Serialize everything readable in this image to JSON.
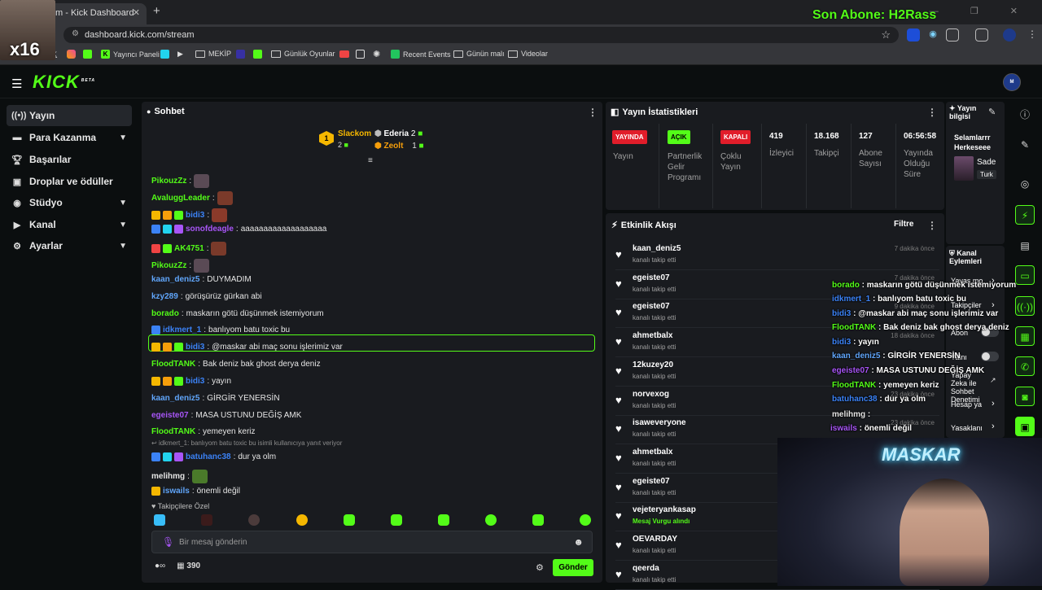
{
  "browser": {
    "tab_title": "m - Kick Dashboard",
    "url": "dashboard.kick.com/stream",
    "bookmarks": [
      "Yayıncı Paneli",
      "MEKİP",
      "Günlük Oyunlar",
      "Recent Events",
      "Günün malı",
      "Videolar"
    ]
  },
  "stream_overlay": {
    "last_sub": "Son Abone: H2Rass",
    "cam_label": "x16",
    "neon_sign": "MASKAR"
  },
  "brand": {
    "logo": "KICK",
    "tag": "BETA",
    "accent": "#53fc18"
  },
  "sidebar": {
    "items": [
      {
        "label": "Yayın",
        "icon": "broadcast-icon",
        "active": true
      },
      {
        "label": "Para Kazanma",
        "icon": "wallet-icon",
        "chevron": true
      },
      {
        "label": "Başarılar",
        "icon": "trophy-icon"
      },
      {
        "label": "Droplar ve ödüller",
        "icon": "gift-icon"
      },
      {
        "label": "Stüdyo",
        "icon": "studio-icon",
        "chevron": true
      },
      {
        "label": "Kanal",
        "icon": "channel-icon",
        "chevron": true
      },
      {
        "label": "Ayarlar",
        "icon": "gear-icon",
        "chevron": true
      }
    ]
  },
  "chat": {
    "title": "Sohbet",
    "podium": {
      "first": {
        "name": "Slackom",
        "count": "2"
      },
      "second": {
        "name": "Ederia",
        "count": "2"
      },
      "third": {
        "name": "Zeolt",
        "count": "1"
      }
    },
    "messages": [
      {
        "user": "PikouzZz",
        "text": "",
        "color": "#53fc18"
      },
      {
        "user": "AvaluggLeader",
        "text": "",
        "color": "#53fc18"
      },
      {
        "user": "bidi3",
        "text": "",
        "color": "#3b82f6"
      },
      {
        "user": "sonofdeagle",
        "text": "aaaaaaaaaaaaaaaaaaa",
        "color": "#a855f7"
      },
      {
        "user": "AK4751",
        "text": "",
        "color": "#53fc18"
      },
      {
        "user": "PikouzZz",
        "text": "",
        "color": "#53fc18"
      },
      {
        "user": "kaan_deniz5",
        "text": "DUYMADIM",
        "color": "#60a5fa"
      },
      {
        "user": "kzy289",
        "text": "görüşürüz gürkan abi",
        "color": "#60a5fa"
      },
      {
        "user": "borado",
        "text": "maskarın götü düşünmek istemiyorum",
        "color": "#53fc18"
      },
      {
        "user": "idkmert_1",
        "text": "banlıyom batu toxic bu",
        "color": "#3b82f6"
      },
      {
        "user": "bidi3",
        "text": "@maskar abi maç sonu işlerimiz var",
        "color": "#3b82f6"
      },
      {
        "user": "FloodTANK",
        "text": "Bak deniz bak ghost derya deniz",
        "color": "#53fc18"
      },
      {
        "user": "bidi3",
        "text": "yayın",
        "color": "#3b82f6"
      },
      {
        "user": "kaan_deniz5",
        "text": "GİRGİR YENERSİN",
        "color": "#60a5fa"
      },
      {
        "user": "egeiste07",
        "text": "MASA USTUNU DEĞİŞ AMK",
        "color": "#a855f7"
      },
      {
        "user": "FloodTANK",
        "text": "yemeyen keriz",
        "color": "#53fc18"
      },
      {
        "user": "batuhanc38",
        "text": "dur ya olm",
        "color": "#3b82f6"
      },
      {
        "user": "melihmg",
        "text": "",
        "color": "#e5e5e5"
      },
      {
        "user": "iswails",
        "text": "önemli değil",
        "color": "#60a5fa"
      }
    ],
    "reply_hint": "idkmert_1: banlıyom batu toxic bu isimli kullanıcıya yanıt veriyor",
    "follower_emotes_label": "Takipçilere Özel",
    "input_placeholder": "Bir mesaj gönderin",
    "points": "390",
    "send_label": "Gönder"
  },
  "stats": {
    "title": "Yayın İstatistikleri",
    "pills": [
      {
        "label": "YAYINDA",
        "caption": "Yayın",
        "color": "#e11d2a"
      },
      {
        "label": "AÇIK",
        "caption": "Partnerlik Gelir Programı",
        "color": "#53fc18"
      },
      {
        "label": "KAPALI",
        "caption": "Çoklu Yayın",
        "color": "#e11d2a"
      }
    ],
    "values": [
      {
        "value": "419",
        "caption": "İzleyici"
      },
      {
        "value": "18.168",
        "caption": "Takipçi"
      },
      {
        "value": "127",
        "caption": "Abone Sayısı"
      },
      {
        "value": "06:56:58",
        "caption": "Yayında Olduğu Süre"
      }
    ]
  },
  "activity": {
    "title": "Etkinlik Akışı",
    "filter_label": "Filtre",
    "events": [
      {
        "name": "kaan_deniz5",
        "action": "kanalı takip etti",
        "time": "7 dakika önce"
      },
      {
        "name": "egeiste07",
        "action": "kanalı takip etti",
        "time": "7 dakika önce"
      },
      {
        "name": "egeiste07",
        "action": "kanalı takip etti",
        "time": "9 dakika önce"
      },
      {
        "name": "ahmetbalx",
        "action": "kanalı takip etti",
        "time": "18 dakika önce"
      },
      {
        "name": "12kuzey20",
        "action": "kanalı takip etti",
        "time": ""
      },
      {
        "name": "norvexog",
        "action": "kanalı takip etti",
        "time": "23 dakika önce"
      },
      {
        "name": "isaweveryone",
        "action": "kanalı takip etti",
        "time": "23 dakika önce"
      },
      {
        "name": "ahmetbalx",
        "action": "kanalı takip etti",
        "time": ""
      },
      {
        "name": "egeiste07",
        "action": "kanalı takip etti",
        "time": ""
      },
      {
        "name": "vejeteryankasap",
        "action": "Mesaj Vurgu alındı",
        "time": ""
      },
      {
        "name": "OEVARDAY",
        "action": "kanalı takip etti",
        "time": ""
      },
      {
        "name": "qeerda",
        "action": "kanalı takip etti",
        "time": ""
      }
    ]
  },
  "stream_info": {
    "title": "Yayın bilgisi",
    "stream_title": "Selamlarrr Herkeseee",
    "category": "Sade",
    "language": "Turk"
  },
  "channel_actions": {
    "title": "Kanal Eylemleri",
    "items": [
      "Yavaş mo",
      "Takipçiler",
      "Abon",
      "Yalnı",
      "Yapay Zeka ile Sohbet Denetimi",
      "Hesap ya",
      "Yasaklanı"
    ]
  },
  "overlay_chat": [
    {
      "user": "borado",
      "text": ": maskarın götü düşünmek istemiyorum",
      "color": "#53fc18"
    },
    {
      "user": "idkmert_1",
      "text": ": banlıyom batu toxic bu",
      "color": "#3b82f6"
    },
    {
      "user": "bidi3",
      "text": ": @maskar abi maç sonu işlerimiz var",
      "color": "#3b82f6"
    },
    {
      "user": "FloodTANK",
      "text": ": Bak deniz bak ghost derya deniz",
      "color": "#53fc18"
    },
    {
      "user": "bidi3",
      "text": ": yayın",
      "color": "#3b82f6"
    },
    {
      "user": "kaan_deniz5",
      "text": ": GİRGİR YENERSİN",
      "color": "#60a5fa"
    },
    {
      "user": "egeiste07",
      "text": ": MASA USTUNU DEĞİŞ AMK",
      "color": "#a855f7"
    },
    {
      "user": "FloodTANK",
      "text": ": yemeyen keriz",
      "color": "#53fc18"
    },
    {
      "user": "batuhanc38",
      "text": ": dur ya olm",
      "color": "#3b82f6"
    },
    {
      "user": "melihmg",
      "text": ":",
      "color": "#e5e5e5"
    },
    {
      "user": "iswails",
      "text": ": önemli değil",
      "color": "#a855f7"
    }
  ]
}
